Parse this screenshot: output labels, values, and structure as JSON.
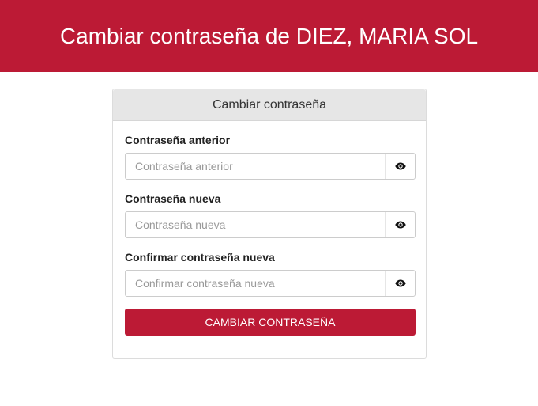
{
  "page": {
    "title": "Cambiar contraseña de DIEZ, MARIA SOL"
  },
  "card": {
    "title": "Cambiar contraseña"
  },
  "fields": [
    {
      "label": "Contraseña anterior",
      "placeholder": "Contraseña anterior",
      "value": "",
      "toggle_icon": "eye-icon"
    },
    {
      "label": "Contraseña nueva",
      "placeholder": "Contraseña nueva",
      "value": "",
      "toggle_icon": "eye-icon"
    },
    {
      "label": "Confirmar contraseña nueva",
      "placeholder": "Confirmar contraseña nueva",
      "value": "",
      "toggle_icon": "eye-icon"
    }
  ],
  "submit": {
    "label": "CAMBIAR CONTRASEÑA"
  },
  "colors": {
    "brand": "#bc1a35",
    "card_header_bg": "#e6e6e6"
  }
}
